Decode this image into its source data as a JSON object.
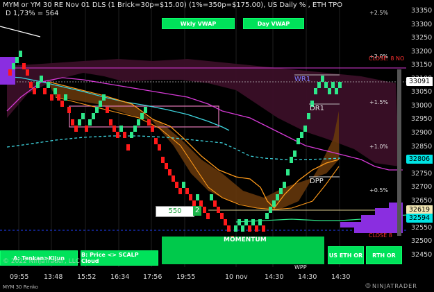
{
  "header": {
    "line1": "MYM or YM 30 RE Nov 01 DLS (1 Brick=30p=$15.00) (1%=350p=$175.00), US Daily % , ETH TPO",
    "line2": "D 1,73% = 564"
  },
  "buttons": {
    "wkly_vwap": "Wkly VWAP",
    "day_vwap": "Day VWAP",
    "tenkan_kijun": "A: Tenkan>Kijun",
    "price_scalp": "B: Price <> SCALP Cloud",
    "us_eth_or": "US ETH OR",
    "rth_or": "RTH OR"
  },
  "copyright": "© 2022 NinjaTrader, LLC",
  "instrument_footer": "MYM 30 Renko",
  "brand": "NINJATRADER",
  "price_axis": [
    "33350",
    "33300",
    "33250",
    "33200",
    "33150",
    "33100",
    "33050",
    "33000",
    "32950",
    "32900",
    "32850",
    "32800",
    "32750",
    "32700",
    "32650",
    "32600",
    "32550",
    "32500",
    "32450"
  ],
  "price_tags": [
    {
      "value": "33091",
      "color": "#ffffff"
    },
    {
      "value": "32806",
      "color": "#00e5e5"
    },
    {
      "value": "32619",
      "color": "#f2e6b3"
    },
    {
      "value": "32594",
      "color": "#00e5e5"
    }
  ],
  "time_axis": [
    "09:55",
    "13:48",
    "15:52",
    "16:34",
    "17:56",
    "19:55",
    "10 nov",
    "14:30",
    "14:30",
    "14:30"
  ],
  "percent_labels": [
    "+2.5%",
    "+2.0%",
    "+1.5%",
    "+1.0%",
    "+0.5%"
  ],
  "levels": {
    "wr1": "WR1",
    "dr1": "DR1",
    "dpp": "DPP",
    "wpp": "WPP",
    "close": "CLOSE: 8 NO",
    "close2": "CLOSE 8"
  },
  "box_550": "550",
  "box_2": "2",
  "momentum": "MOMENTUM",
  "colors": {
    "up_brick": "#2ee88a",
    "down_brick": "#ff1a1a",
    "cloud": "#5a1a3a",
    "orange_band": "#8a4a10",
    "vwap_cyan": "#3fd6e0",
    "magenta": "#d63ad6",
    "accent_green": "#00e25a"
  }
}
